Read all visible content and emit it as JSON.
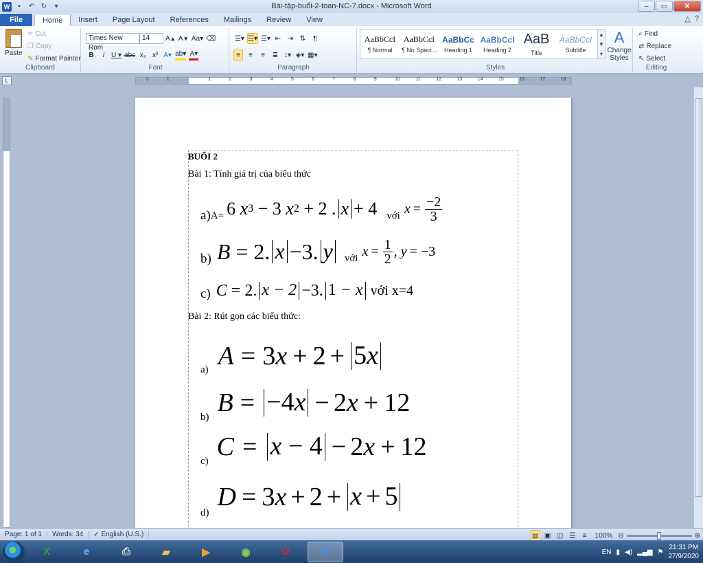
{
  "window": {
    "title": "Bài-tập-buổi-2-toan-NC-7.docx - Microsoft Word",
    "app_icon": "W",
    "controls": {
      "minimize": "–",
      "maximize": "▭",
      "close": "✕"
    }
  },
  "ribbon_tabs": [
    "File",
    "Home",
    "Insert",
    "Page Layout",
    "References",
    "Mailings",
    "Review",
    "View"
  ],
  "active_tab": "Home",
  "clipboard": {
    "paste": "Paste",
    "cut": "Cut",
    "copy": "Copy",
    "format_painter": "Format Painter",
    "label": "Clipboard"
  },
  "font": {
    "name": "Times New Rom",
    "size": "14",
    "label": "Font"
  },
  "paragraph": {
    "label": "Paragraph"
  },
  "styles": {
    "label": "Styles",
    "items": [
      {
        "preview": "AaBbCcI",
        "name": "¶ Normal",
        "color": "#111111"
      },
      {
        "preview": "AaBbCcI",
        "name": "¶ No Spaci...",
        "color": "#111111"
      },
      {
        "preview": "AaBbCc",
        "name": "Heading 1",
        "color": "#2e5fa3"
      },
      {
        "preview": "AaBbCcI",
        "name": "Heading 2",
        "color": "#4f81bd"
      },
      {
        "preview": "AaB",
        "name": "Title",
        "color": "#1f2f45"
      },
      {
        "preview": "AaBbCcI",
        "name": "Subtitle",
        "color": "#7f9bc4"
      }
    ],
    "change_styles": "Change Styles"
  },
  "editing": {
    "find": "Find",
    "replace": "Replace",
    "select": "Select",
    "label": "Editing"
  },
  "ruler": {
    "numbers": [
      "2",
      "1",
      "1",
      "2",
      "3",
      "4",
      "5",
      "6",
      "7",
      "8",
      "9",
      "10",
      "11",
      "12",
      "13",
      "14",
      "15",
      "16",
      "17",
      "18"
    ]
  },
  "document": {
    "heading": "BUỔI 2",
    "bai1_title": "Bài 1: Tính giá trị của biểu thức",
    "bai1": {
      "a_label": "a)",
      "a_prefix": "A=",
      "a_with": "với",
      "b_label": "b)",
      "b_with": "với",
      "c_label": "c)",
      "c_with": "với x=4"
    },
    "bai2_title": "Bài 2: Rút gọn các biểu thức:",
    "bai2": {
      "a_label": "a)",
      "b_label": "b)",
      "c_label": "c)",
      "d_label": "d)"
    }
  },
  "status": {
    "page": "Page: 1 of 1",
    "words": "Words: 34",
    "language": "English (U.S.)",
    "zoom": "100%"
  },
  "taskbar": {
    "tray_lang": "EN",
    "time": "21:31 PM",
    "date": "27/9/2020"
  }
}
